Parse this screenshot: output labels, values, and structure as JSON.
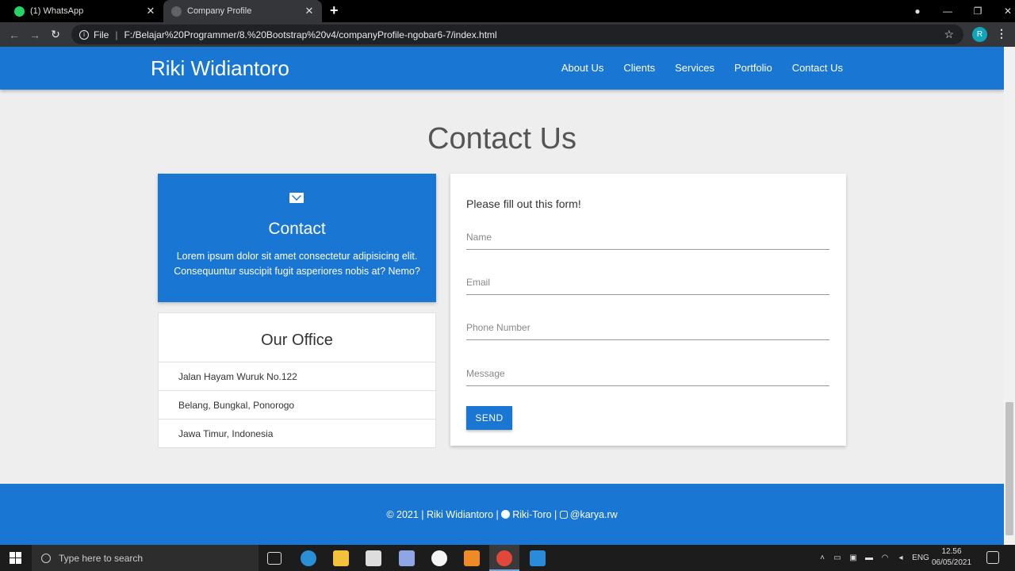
{
  "browser": {
    "tabs": [
      {
        "title": "(1) WhatsApp",
        "active": false,
        "favicon": "whatsapp-icon"
      },
      {
        "title": "Company Profile",
        "active": true,
        "favicon": "globe-icon"
      }
    ],
    "new_tab": "+",
    "address": {
      "scheme_label": "File",
      "url": "F:/Belajar%20Programmer/8.%20Bootstrap%20v4/companyProfile-ngobar6-7/index.html"
    },
    "profile_initial": "R",
    "window_controls": {
      "minimize": "—",
      "restore": "❐",
      "close": "✕"
    }
  },
  "navbar": {
    "brand": "Riki Widiantoro",
    "links": [
      "About Us",
      "Clients",
      "Services",
      "Portfolio",
      "Contact Us"
    ]
  },
  "contact_section": {
    "title": "Contact Us",
    "contact_card": {
      "title": "Contact",
      "text": "Lorem ipsum dolor sit amet consectetur adipisicing elit. Consequuntur suscipit fugit asperiores nobis at? Nemo?"
    },
    "office": {
      "title": "Our Office",
      "lines": [
        "Jalan Hayam Wuruk No.122",
        "Belang, Bungkal, Ponorogo",
        "Jawa Timur, Indonesia"
      ]
    },
    "form": {
      "heading": "Please fill out this form!",
      "name_placeholder": "Name",
      "email_placeholder": "Email",
      "phone_placeholder": "Phone Number",
      "message_placeholder": "Message",
      "send_label": "SEND"
    }
  },
  "footer": {
    "copyright": "© 2021 | Riki Widiantoro | ",
    "github": "Riki-Toro",
    "separator": " | ",
    "instagram": "@karya.rw"
  },
  "taskbar": {
    "search_placeholder": "Type here to search",
    "language": "ENG",
    "time": "12.56",
    "date": "06/05/2021"
  },
  "colors": {
    "primary": "#1976d2",
    "page_bg": "#eeeeee"
  }
}
